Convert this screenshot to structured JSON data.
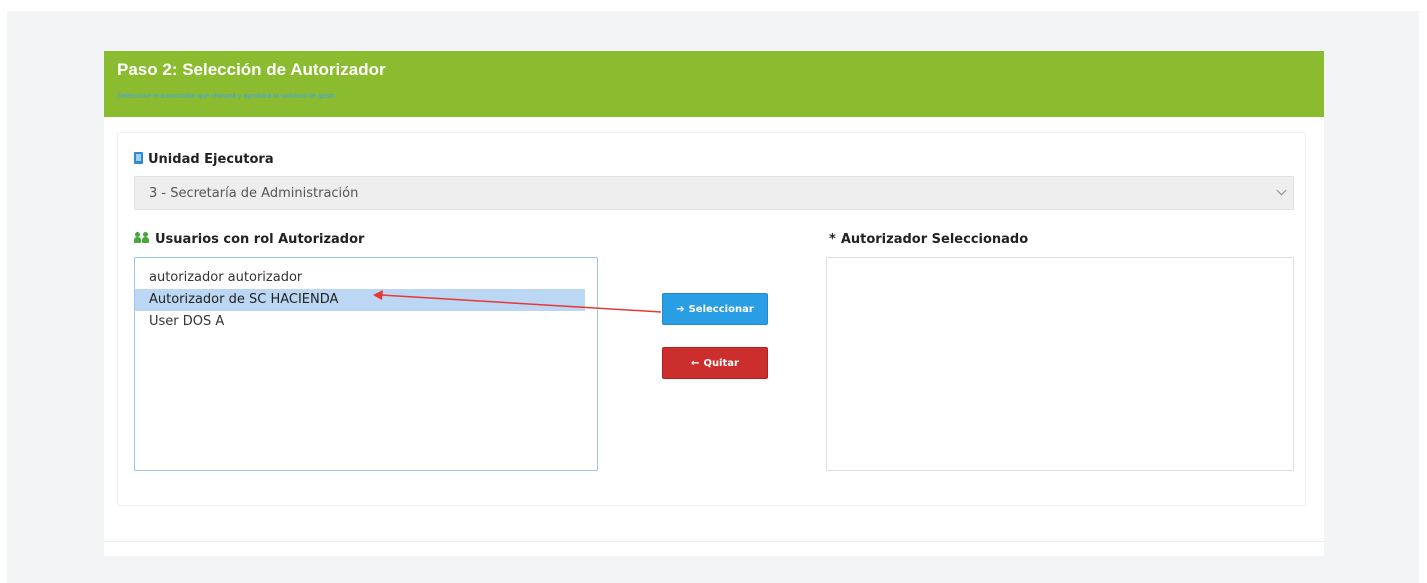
{
  "header": {
    "title": "Paso 2: Selección de Autorizador",
    "subtitle": "Seleccione el autorizador que revisará y aprobará la solicitud de gasto"
  },
  "unidad": {
    "label": "Unidad Ejecutora",
    "icon": "book-icon",
    "selected_value": "3 - Secretaría de Administración"
  },
  "usuarios": {
    "label": "Usuarios con rol Autorizador",
    "icon": "users-icon",
    "options": [
      "autorizador autorizador",
      "Autorizador de SC HACIENDA",
      "User DOS A"
    ],
    "selected_index": 1
  },
  "actions": {
    "select_label": "Seleccionar",
    "select_icon": "arrow-right-icon",
    "remove_label": "Quitar",
    "remove_icon": "arrow-left-icon"
  },
  "autorizador": {
    "required_mark": "*",
    "label": "Autorizador Seleccionado"
  },
  "colors": {
    "header_green": "#8bbb2e",
    "primary_blue": "#2a9ee4",
    "danger_red": "#cc2d2d",
    "annotation_arrow": "#e53935"
  }
}
